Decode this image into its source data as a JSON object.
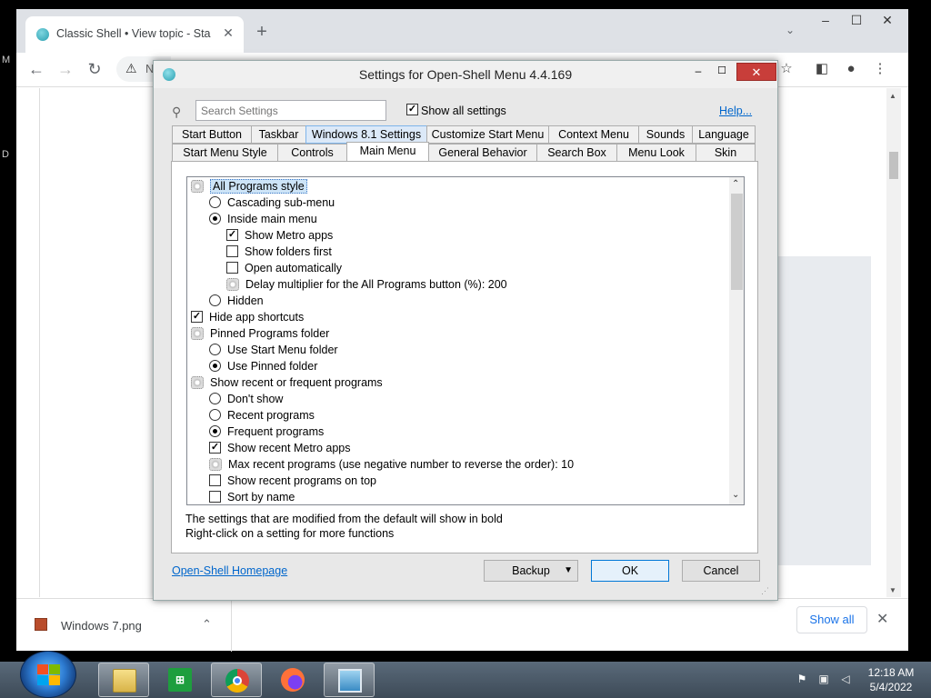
{
  "browser": {
    "tab_title": "Classic Shell • View topic - Start Menu",
    "tab_close": "✕",
    "new_tab": "+",
    "address_prefix": "N",
    "minimize": "–",
    "maximize": "☐",
    "close": "✕"
  },
  "dialog": {
    "title": "Settings for Open-Shell Menu 4.4.169",
    "search_placeholder": "Search Settings",
    "show_all_label": "Show all settings",
    "help_link": "Help...",
    "tabs_row1": [
      "Start Button",
      "Taskbar",
      "Windows 8.1 Settings",
      "Customize Start Menu",
      "Context Menu",
      "Sounds",
      "Language"
    ],
    "tabs_row2": [
      "Start Menu Style",
      "Controls",
      "Main Menu",
      "General Behavior",
      "Search Box",
      "Menu Look",
      "Skin"
    ],
    "selected_tab": "Main Menu",
    "settings": [
      {
        "type": "group",
        "label": "All Programs style",
        "selected": true
      },
      {
        "type": "radio",
        "label": "Cascading sub-menu",
        "checked": false
      },
      {
        "type": "radio",
        "label": "Inside main menu",
        "checked": true
      },
      {
        "type": "check",
        "label": "Show Metro apps",
        "checked": true
      },
      {
        "type": "check",
        "label": "Show folders first",
        "checked": false
      },
      {
        "type": "check",
        "label": "Open automatically",
        "checked": false
      },
      {
        "type": "value",
        "label": "Delay multiplier for the All Programs button (%): 200"
      },
      {
        "type": "radio",
        "label": "Hidden",
        "checked": false
      },
      {
        "type": "check",
        "label": "Hide app shortcuts",
        "checked": true
      },
      {
        "type": "group",
        "label": "Pinned Programs folder"
      },
      {
        "type": "radio",
        "label": "Use Start Menu folder",
        "checked": false
      },
      {
        "type": "radio",
        "label": "Use Pinned folder",
        "checked": true
      },
      {
        "type": "group",
        "label": "Show recent or frequent programs"
      },
      {
        "type": "radio",
        "label": "Don't show",
        "checked": false
      },
      {
        "type": "radio",
        "label": "Recent programs",
        "checked": false
      },
      {
        "type": "radio",
        "label": "Frequent programs",
        "checked": true
      },
      {
        "type": "check",
        "label": "Show recent Metro apps",
        "checked": true
      },
      {
        "type": "value",
        "label": "Max recent programs (use negative number to reverse the order): 10"
      },
      {
        "type": "check",
        "label": "Show recent programs on top",
        "checked": false
      },
      {
        "type": "check",
        "label": "Sort by name",
        "checked": false
      }
    ],
    "info_line1": "The settings that are modified from the default will show in bold",
    "info_line2": "Right-click on a setting for more functions",
    "homepage_link": "Open-Shell Homepage",
    "backup_button": "Backup",
    "ok_button": "OK",
    "cancel_button": "Cancel"
  },
  "downloads": {
    "file_name": "Windows 7.png",
    "show_all": "Show all"
  },
  "taskbar": {
    "time": "12:18 AM",
    "date": "5/4/2022"
  },
  "colors": {
    "accent": "#0078d7",
    "link": "#0066cc",
    "close_red": "#c83e3a"
  }
}
